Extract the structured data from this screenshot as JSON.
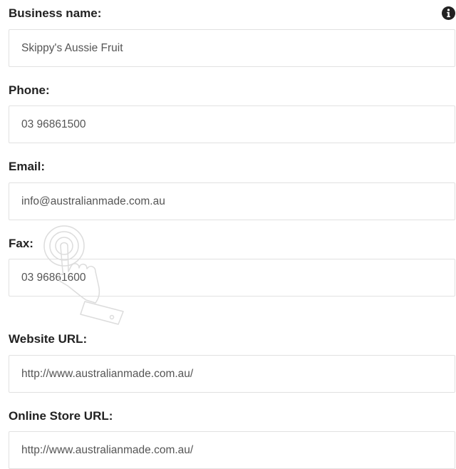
{
  "form": {
    "fields": [
      {
        "id": "business-name",
        "label": "Business name:",
        "value": "Skippy's Aussie Fruit"
      },
      {
        "id": "phone",
        "label": "Phone:",
        "value": "03 96861500"
      },
      {
        "id": "email",
        "label": "Email:",
        "value": "info@australianmade.com.au"
      },
      {
        "id": "fax",
        "label": "Fax:",
        "value": "03 96861600"
      },
      {
        "id": "website-url",
        "label": "Website URL:",
        "value": "http://www.australianmade.com.au/"
      },
      {
        "id": "online-store-url",
        "label": "Online Store URL:",
        "value": "http://www.australianmade.com.au/"
      }
    ],
    "info_icon": "info-circle-icon",
    "watermark_icon": "tap-gesture-icon"
  },
  "colors": {
    "label_text": "#222222",
    "input_text": "#555555",
    "input_border": "#e1e1e1",
    "icon": "#222222"
  }
}
